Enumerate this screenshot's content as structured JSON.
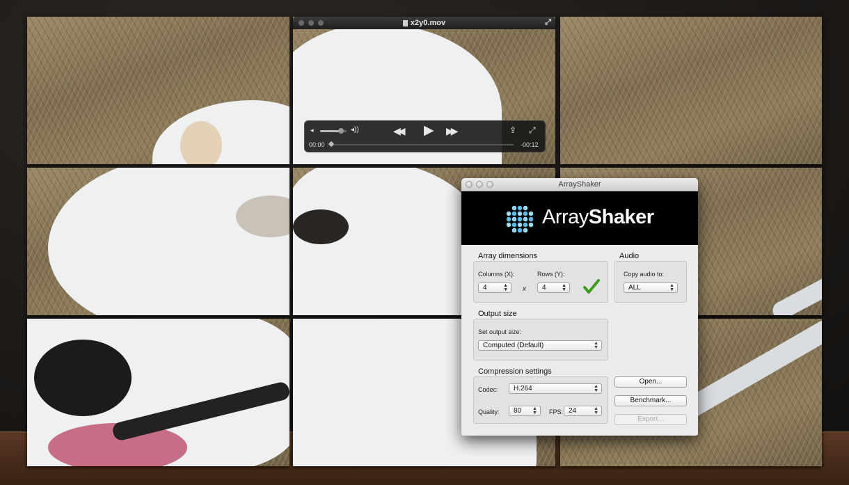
{
  "quicktime": {
    "filename": "x2y0.mov",
    "time_elapsed": "00:00",
    "time_remaining": "-00:12",
    "volume_fraction": 0.8,
    "playback_fraction": 0.0,
    "icons": [
      "file-icon",
      "fullscreen-icon",
      "volume-low-icon",
      "volume-high-icon",
      "rewind-icon",
      "play-icon",
      "fast-forward-icon",
      "share-icon",
      "expand-icon"
    ]
  },
  "arrayshaker": {
    "window_title": "ArrayShaker",
    "brand_light": "Array",
    "brand_bold": "Shaker",
    "array_dimensions": {
      "heading": "Array dimensions",
      "columns_label": "Columns (X):",
      "columns_value": "4",
      "times": "x",
      "rows_label": "Rows (Y):",
      "rows_value": "4",
      "valid_icon": "checkmark-icon",
      "valid_color": "#3c9a1c"
    },
    "audio": {
      "heading": "Audio",
      "copy_label": "Copy audio to:",
      "copy_value": "ALL"
    },
    "output_size": {
      "heading": "Output size",
      "set_label": "Set output size:",
      "value": "Computed (Default)"
    },
    "compression": {
      "heading": "Compression settings",
      "codec_label": "Codec:",
      "codec_value": "H.264",
      "quality_label": "Quality:",
      "quality_value": "80",
      "fps_label": "FPS:",
      "fps_value": "24"
    },
    "buttons": {
      "open": "Open...",
      "benchmark": "Benchmark...",
      "export": "Export..."
    }
  }
}
